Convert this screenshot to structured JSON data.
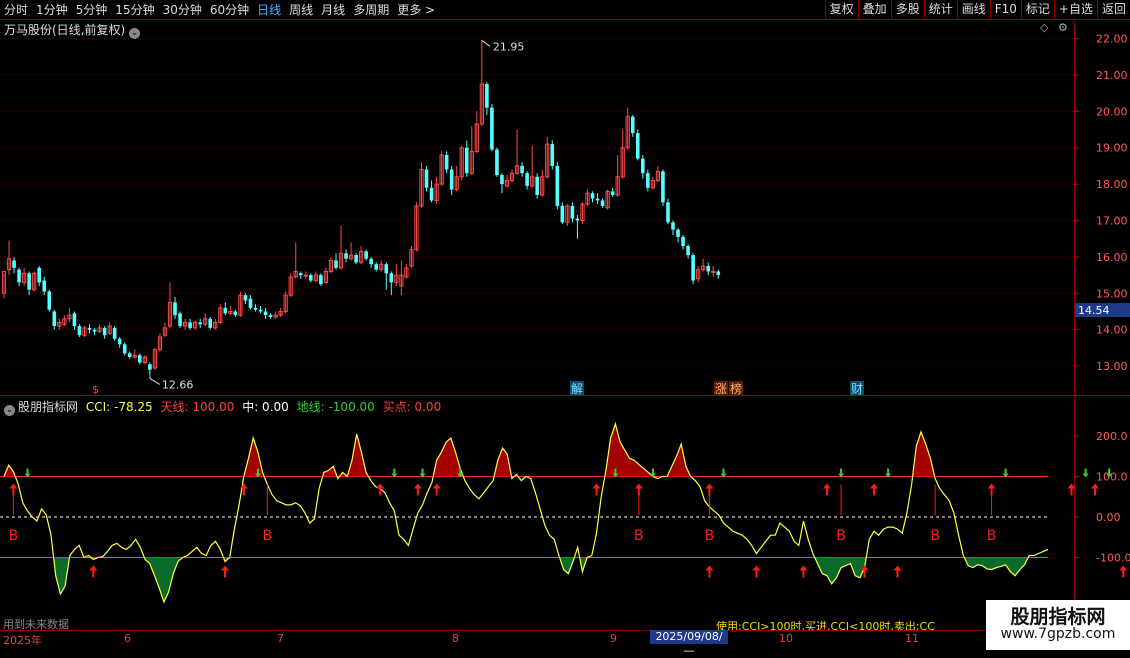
{
  "toolbar": {
    "periods": [
      "分时",
      "1分钟",
      "5分钟",
      "15分钟",
      "30分钟",
      "60分钟",
      "日线",
      "周线",
      "月线",
      "多周期",
      "更多 >"
    ],
    "active_period": "日线",
    "tools": [
      "复权",
      "叠加",
      "多股",
      "统计",
      "画线",
      "F10",
      "标记",
      "+自选",
      "返回"
    ]
  },
  "stock": {
    "title": "万马股份(日线,前复权)"
  },
  "colors": {
    "up": "#ff4a4a",
    "down": "#54ffff",
    "cci": "#ffff40",
    "sky": "#ff2a2a",
    "ground": "#00d000",
    "mid": "#ffffff",
    "buy": "#ff1a1a",
    "fill_up": "#a30000",
    "fill_down": "#0b6b2a",
    "label": "#ff5a5a",
    "accent": "#4ab3ff"
  },
  "price_axis": {
    "ticks": [
      "22.00",
      "21.00",
      "20.00",
      "19.00",
      "18.00",
      "17.00",
      "16.00",
      "15.00",
      "14.00",
      "13.00"
    ],
    "current": "14.54"
  },
  "annotations": {
    "high": "21.95",
    "low": "12.66"
  },
  "event_markers": [
    "$",
    "解",
    "涨",
    "榜",
    "财"
  ],
  "indicator": {
    "name": "股朋指标网",
    "cci_label": "CCI: -78.25",
    "sky_label": "天线: 100.00",
    "mid_label": "中: 0.00",
    "ground_label": "地线: -100.00",
    "buy_label": "买点: 0.00"
  },
  "cci_axis": {
    "ticks": [
      "200.0",
      "100.0",
      "0.00",
      "-100.0"
    ]
  },
  "buy_signal_label": "B",
  "notes": {
    "future": "用到未来数据",
    "usage": "使用:CCI>100时,买进,CCI<100时,卖出;CC"
  },
  "watermark": {
    "line1": "股朋指标网",
    "line2": "www.7gpzb.com"
  },
  "time_axis": {
    "labels": [
      "2025年",
      "6",
      "7",
      "8",
      "9",
      "10",
      "11"
    ],
    "selected": "2025/09/08/—"
  },
  "chart_data": [
    {
      "type": "candlestick",
      "title": "万马股份(日线,前复权)",
      "ylim": [
        12.6,
        22.2
      ],
      "candles": [
        [
          15.0,
          15.6,
          15.55,
          14.85
        ],
        [
          15.65,
          15.95,
          16.45,
          15.5
        ],
        [
          15.9,
          15.7,
          16.0,
          15.55
        ],
        [
          15.65,
          15.3,
          15.7,
          15.2
        ],
        [
          15.3,
          15.55,
          15.7,
          15.2
        ],
        [
          15.55,
          15.1,
          15.6,
          14.95
        ],
        [
          15.1,
          15.55,
          15.6,
          15.05
        ],
        [
          15.7,
          15.3,
          15.75,
          15.2
        ],
        [
          15.35,
          15.05,
          15.45,
          14.95
        ],
        [
          15.05,
          14.55,
          15.1,
          14.5
        ],
        [
          14.5,
          14.1,
          14.55,
          14.0
        ],
        [
          14.1,
          14.2,
          14.3,
          14.0
        ],
        [
          14.15,
          14.3,
          14.4,
          14.1
        ],
        [
          14.3,
          14.4,
          14.6,
          14.2
        ],
        [
          14.45,
          14.1,
          14.5,
          14.0
        ],
        [
          14.1,
          13.85,
          14.15,
          13.8
        ],
        [
          13.85,
          14.05,
          14.1,
          13.8
        ],
        [
          14.05,
          14.0,
          14.15,
          13.9
        ],
        [
          14.0,
          13.95,
          14.05,
          13.85
        ],
        [
          13.95,
          14.05,
          14.15,
          13.9
        ],
        [
          14.05,
          13.85,
          14.1,
          13.75
        ],
        [
          13.9,
          14.1,
          14.2,
          13.85
        ],
        [
          14.05,
          13.75,
          14.1,
          13.7
        ],
        [
          13.75,
          13.6,
          13.8,
          13.5
        ],
        [
          13.6,
          13.35,
          13.65,
          13.3
        ],
        [
          13.35,
          13.25,
          13.4,
          13.2
        ],
        [
          13.25,
          13.3,
          13.45,
          13.2
        ],
        [
          13.3,
          13.1,
          13.35,
          13.05
        ],
        [
          13.1,
          13.25,
          13.3,
          13.05
        ],
        [
          13.05,
          12.9,
          13.1,
          12.66
        ],
        [
          12.95,
          13.45,
          13.5,
          12.9
        ],
        [
          13.45,
          13.8,
          13.9,
          13.4
        ],
        [
          13.85,
          14.05,
          14.2,
          13.8
        ],
        [
          14.1,
          14.75,
          15.3,
          14.05
        ],
        [
          14.75,
          14.4,
          14.9,
          14.3
        ],
        [
          14.45,
          14.1,
          14.5,
          14.05
        ],
        [
          14.1,
          14.2,
          14.3,
          14.0
        ],
        [
          14.2,
          14.05,
          14.3,
          14.0
        ],
        [
          14.05,
          14.2,
          14.25,
          14.0
        ],
        [
          14.2,
          14.15,
          14.3,
          14.05
        ],
        [
          14.15,
          14.3,
          14.45,
          14.1
        ],
        [
          14.3,
          14.05,
          14.35,
          14.0
        ],
        [
          14.05,
          14.2,
          14.3,
          14.0
        ],
        [
          14.2,
          14.6,
          14.7,
          14.15
        ],
        [
          14.6,
          14.45,
          14.75,
          14.4
        ],
        [
          14.45,
          14.5,
          14.65,
          14.4
        ],
        [
          14.5,
          14.4,
          14.55,
          14.35
        ],
        [
          14.4,
          14.95,
          15.05,
          14.35
        ],
        [
          14.95,
          14.8,
          15.0,
          14.7
        ],
        [
          14.85,
          14.6,
          14.95,
          14.55
        ],
        [
          14.6,
          14.55,
          14.7,
          14.5
        ],
        [
          14.55,
          14.5,
          14.65,
          14.45
        ],
        [
          14.5,
          14.4,
          14.6,
          14.3
        ],
        [
          14.4,
          14.35,
          14.45,
          14.3
        ],
        [
          14.35,
          14.4,
          14.5,
          14.3
        ],
        [
          14.4,
          14.5,
          14.6,
          14.35
        ],
        [
          14.5,
          14.95,
          15.05,
          14.45
        ],
        [
          14.95,
          15.45,
          15.55,
          14.9
        ],
        [
          15.45,
          15.6,
          16.4,
          15.4
        ],
        [
          15.55,
          15.5,
          15.6,
          15.4
        ],
        [
          15.5,
          15.5,
          15.6,
          15.4
        ],
        [
          15.5,
          15.35,
          15.55,
          15.3
        ],
        [
          15.35,
          15.5,
          15.6,
          15.3
        ],
        [
          15.5,
          15.25,
          15.55,
          15.2
        ],
        [
          15.3,
          15.6,
          15.7,
          15.25
        ],
        [
          15.6,
          15.9,
          16.0,
          15.55
        ],
        [
          15.9,
          15.7,
          16.1,
          15.65
        ],
        [
          15.7,
          16.1,
          16.85,
          15.65
        ],
        [
          16.1,
          15.95,
          16.2,
          15.85
        ],
        [
          15.95,
          16.05,
          16.4,
          15.9
        ],
        [
          16.05,
          15.85,
          16.1,
          15.8
        ],
        [
          15.85,
          16.15,
          16.3,
          15.8
        ],
        [
          16.15,
          15.95,
          16.2,
          15.9
        ],
        [
          15.95,
          15.8,
          16.0,
          15.7
        ],
        [
          15.8,
          15.65,
          15.85,
          15.6
        ],
        [
          15.65,
          15.8,
          15.9,
          15.6
        ],
        [
          15.8,
          15.55,
          15.85,
          15.1
        ],
        [
          15.55,
          15.3,
          15.6,
          14.95
        ],
        [
          15.3,
          15.5,
          15.8,
          15.2
        ],
        [
          15.2,
          15.5,
          15.9,
          14.95
        ],
        [
          15.45,
          15.7,
          15.8,
          15.4
        ],
        [
          15.75,
          16.2,
          16.3,
          15.7
        ],
        [
          16.2,
          17.4,
          17.5,
          16.15
        ],
        [
          17.4,
          18.4,
          18.6,
          17.35
        ],
        [
          18.4,
          17.9,
          18.5,
          17.8
        ],
        [
          17.9,
          17.55,
          18.1,
          17.5
        ],
        [
          17.55,
          18.0,
          18.2,
          17.45
        ],
        [
          18.0,
          18.8,
          18.9,
          17.95
        ],
        [
          18.8,
          18.4,
          18.9,
          18.3
        ],
        [
          18.4,
          17.85,
          18.5,
          17.7
        ],
        [
          17.85,
          18.2,
          18.5,
          17.8
        ],
        [
          18.2,
          19.0,
          19.05,
          18.1
        ],
        [
          19.0,
          18.3,
          19.2,
          18.2
        ],
        [
          18.3,
          18.9,
          19.6,
          18.25
        ],
        [
          18.9,
          19.65,
          20.0,
          18.85
        ],
        [
          19.65,
          20.75,
          21.95,
          19.6
        ],
        [
          20.75,
          20.1,
          20.8,
          19.9
        ],
        [
          20.1,
          18.95,
          20.2,
          18.9
        ],
        [
          18.95,
          18.25,
          19.0,
          18.2
        ],
        [
          18.25,
          18.0,
          18.3,
          17.75
        ],
        [
          17.95,
          18.1,
          18.25,
          17.9
        ],
        [
          18.1,
          18.3,
          18.4,
          18.05
        ],
        [
          18.3,
          18.5,
          19.5,
          18.25
        ],
        [
          18.5,
          18.3,
          18.6,
          18.2
        ],
        [
          18.3,
          17.95,
          18.35,
          17.85
        ],
        [
          17.95,
          18.2,
          19.05,
          17.9
        ],
        [
          18.2,
          17.7,
          18.3,
          17.6
        ],
        [
          17.7,
          18.2,
          18.4,
          17.65
        ],
        [
          18.2,
          19.1,
          19.3,
          18.15
        ],
        [
          19.1,
          18.5,
          19.2,
          18.4
        ],
        [
          18.5,
          17.4,
          18.6,
          17.3
        ],
        [
          17.4,
          16.95,
          17.5,
          16.9
        ],
        [
          16.95,
          17.4,
          17.45,
          16.85
        ],
        [
          17.4,
          17.05,
          17.5,
          16.95
        ],
        [
          17.05,
          17.0,
          17.15,
          16.5
        ],
        [
          17.0,
          17.45,
          17.5,
          16.9
        ],
        [
          17.45,
          17.75,
          17.85,
          17.4
        ],
        [
          17.75,
          17.6,
          17.8,
          17.5
        ],
        [
          17.6,
          17.55,
          17.75,
          17.45
        ],
        [
          17.55,
          17.4,
          17.6,
          17.35
        ],
        [
          17.35,
          17.8,
          17.85,
          17.3
        ],
        [
          17.8,
          17.7,
          17.9,
          17.65
        ],
        [
          17.7,
          18.2,
          18.8,
          17.65
        ],
        [
          18.2,
          19.0,
          19.5,
          18.15
        ],
        [
          19.0,
          19.85,
          20.1,
          18.95
        ],
        [
          19.85,
          19.4,
          19.9,
          19.3
        ],
        [
          19.4,
          18.7,
          19.5,
          18.65
        ],
        [
          18.7,
          18.3,
          18.8,
          18.15
        ],
        [
          18.3,
          17.9,
          18.4,
          17.8
        ],
        [
          17.9,
          18.1,
          18.2,
          17.85
        ],
        [
          18.1,
          18.35,
          18.5,
          18.05
        ],
        [
          18.35,
          17.5,
          18.4,
          17.4
        ],
        [
          17.5,
          16.95,
          17.6,
          16.9
        ],
        [
          16.95,
          16.75,
          17.0,
          16.6
        ],
        [
          16.75,
          16.55,
          16.8,
          16.4
        ],
        [
          16.55,
          16.3,
          16.6,
          16.2
        ],
        [
          16.3,
          16.05,
          16.35,
          15.95
        ],
        [
          16.05,
          15.35,
          16.1,
          15.25
        ],
        [
          15.4,
          15.65,
          15.75,
          15.3
        ],
        [
          15.65,
          15.75,
          15.95,
          15.6
        ],
        [
          15.75,
          15.6,
          15.85,
          15.5
        ],
        [
          15.6,
          15.6,
          15.75,
          15.45
        ],
        [
          15.6,
          15.5,
          15.65,
          15.4
        ]
      ]
    },
    {
      "type": "line",
      "title": "股朋指标网",
      "ylim": [
        -230,
        270
      ],
      "reference_lines": {
        "sky": 100,
        "mid": 0,
        "ground": -100
      },
      "series": [
        {
          "name": "CCI",
          "values": [
            100,
            128,
            112,
            82,
            35,
            15,
            0,
            -10,
            20,
            5,
            -45,
            -145,
            -190,
            -170,
            -95,
            -80,
            -70,
            -100,
            -95,
            -105,
            -100,
            -98,
            -85,
            -70,
            -65,
            -75,
            -80,
            -70,
            -55,
            -75,
            -105,
            -115,
            -145,
            -175,
            -210,
            -185,
            -140,
            -110,
            -100,
            -95,
            -85,
            -75,
            -90,
            -95,
            -70,
            -60,
            -80,
            -110,
            -100,
            -30,
            30,
            100,
            145,
            195,
            160,
            110,
            80,
            55,
            40,
            35,
            30,
            30,
            35,
            28,
            10,
            -15,
            -5,
            70,
            110,
            115,
            125,
            95,
            110,
            100,
            140,
            205,
            160,
            110,
            90,
            75,
            70,
            60,
            35,
            15,
            -45,
            -55,
            -70,
            -30,
            10,
            30,
            60,
            85,
            140,
            160,
            185,
            195,
            160,
            120,
            90,
            70,
            55,
            45,
            60,
            75,
            90,
            140,
            170,
            155,
            95,
            105,
            90,
            100,
            95,
            60,
            20,
            -20,
            -45,
            -55,
            -95,
            -130,
            -140,
            -110,
            -75,
            -135,
            -100,
            -95,
            -40,
            50,
            115,
            195,
            230,
            185,
            165,
            145,
            140,
            130,
            120,
            110,
            100,
            95,
            100,
            100,
            125,
            150,
            180,
            125,
            100,
            90,
            75,
            40,
            25,
            15,
            5,
            -15,
            -25,
            -35,
            -40,
            -45,
            -55,
            -70,
            -90,
            -75,
            -60,
            -45,
            -45,
            -15,
            -25,
            -35,
            -60,
            -70,
            -10,
            -55,
            -90,
            -115,
            -140,
            -145,
            -165,
            -150,
            -125,
            -120,
            -115,
            -145,
            -150,
            -125,
            -55,
            -35,
            -45,
            -30,
            -25,
            -25,
            -30,
            -40,
            10,
            80,
            175,
            210,
            180,
            145,
            95,
            70,
            55,
            40,
            10,
            -45,
            -95,
            -120,
            -125,
            -118,
            -120,
            -128,
            -130,
            -125,
            -122,
            -118,
            -135,
            -145,
            -130,
            -118,
            -95,
            -95,
            -90,
            -85,
            -80
          ]
        }
      ],
      "buy_arrows_up_idx": [
        2,
        51,
        80,
        88,
        92,
        126,
        135,
        150,
        175,
        185,
        210,
        227,
        232,
        250
      ],
      "buy_arrows_low_idx": [
        19,
        47,
        150,
        160,
        170,
        183,
        190,
        238
      ],
      "down_arrows_idx": [
        5,
        54,
        83,
        89,
        97,
        130,
        138,
        153,
        178,
        188,
        213,
        230,
        235,
        255
      ]
    }
  ]
}
